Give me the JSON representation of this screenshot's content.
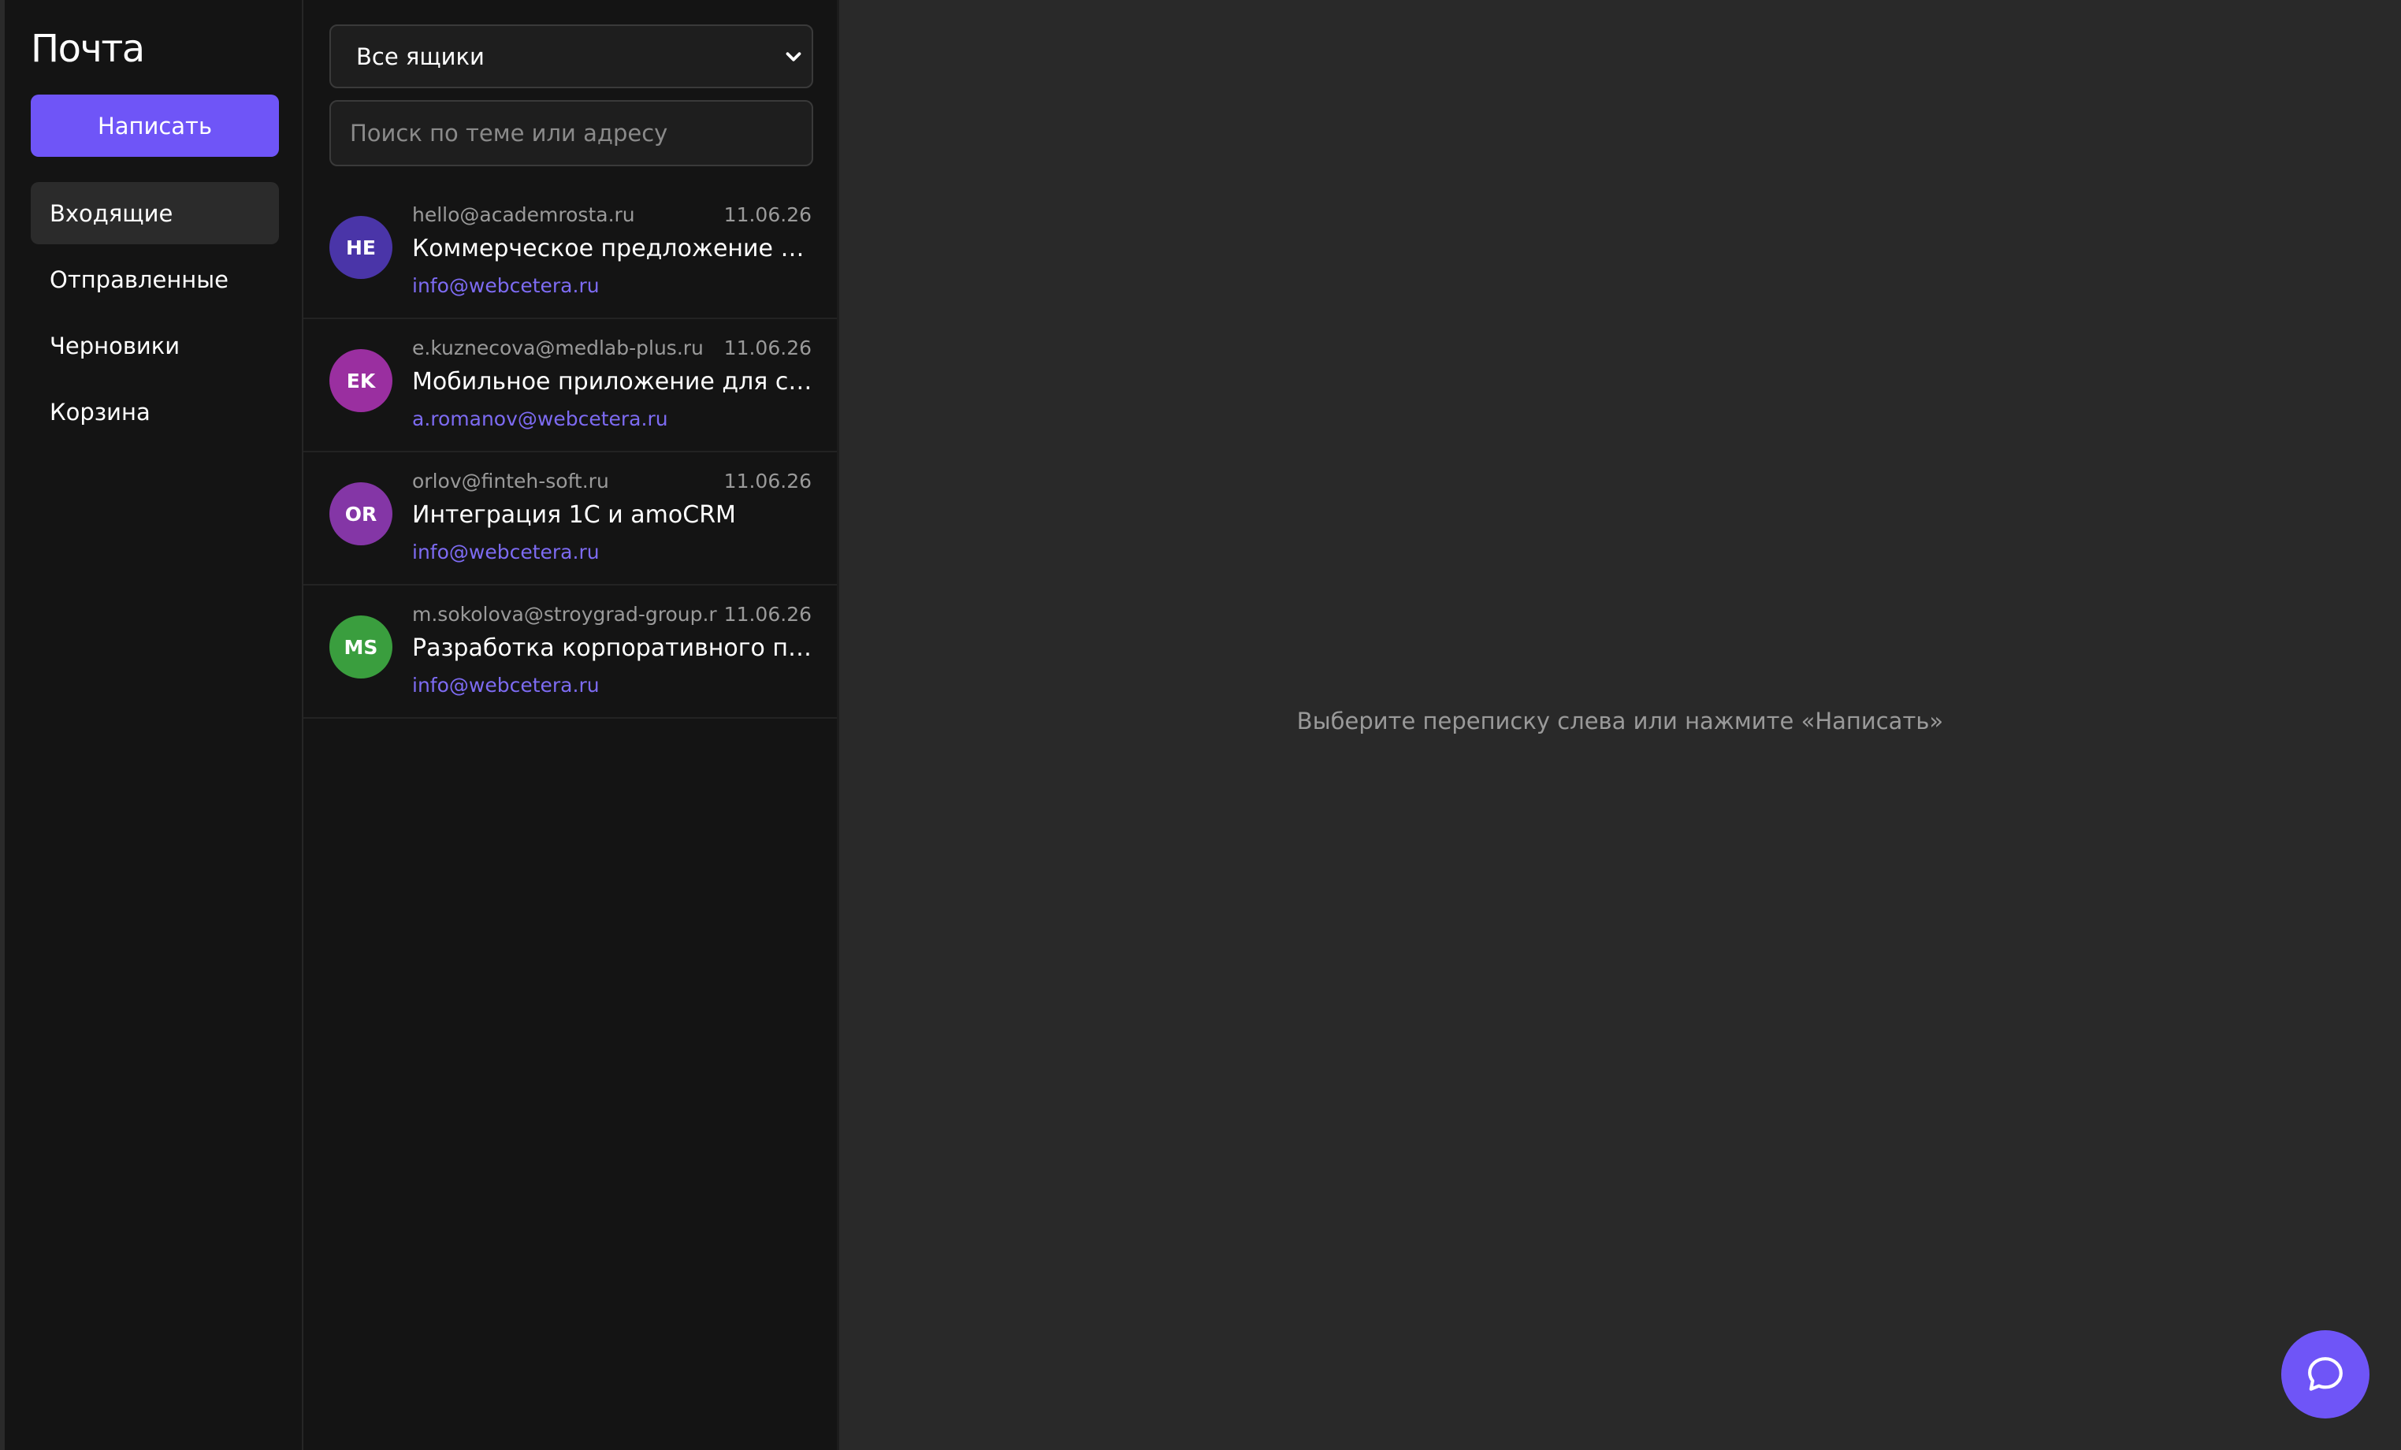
{
  "app": {
    "title": "Почта",
    "compose_label": "Написать"
  },
  "sidebar": {
    "items": [
      {
        "label": "Входящие",
        "active": true
      },
      {
        "label": "Отправленные",
        "active": false
      },
      {
        "label": "Черновики",
        "active": false
      },
      {
        "label": "Корзина",
        "active": false
      }
    ]
  },
  "list": {
    "mailbox_selected": "Все ящики",
    "search_placeholder": "Поиск по теме или адресу",
    "messages": [
      {
        "initials": "HE",
        "avatar_color": "#4a35a8",
        "from": "hello@academrosta.ru",
        "date": "11.06.26",
        "subject": "Коммерческое предложение по продвижению сайта",
        "to": "info@webcetera.ru"
      },
      {
        "initials": "EK",
        "avatar_color": "#9a2fa0",
        "from": "e.kuznecova@medlab-plus.ru",
        "date": "11.06.26",
        "subject": "Мобильное приложение для сети клиник",
        "to": "a.romanov@webcetera.ru"
      },
      {
        "initials": "OR",
        "avatar_color": "#8436a6",
        "from": "orlov@finteh-soft.ru",
        "date": "11.06.26",
        "subject": "Интеграция 1С и amoCRM",
        "to": "info@webcetera.ru"
      },
      {
        "initials": "MS",
        "avatar_color": "#3a9e3e",
        "from": "m.sokolova@stroygrad-group.ru",
        "date": "11.06.26",
        "subject": "Разработка корпоративного портала",
        "to": "info@webcetera.ru"
      }
    ]
  },
  "reading": {
    "empty_hint": "Выберите переписку слева или нажмите «Написать»"
  },
  "icons": {
    "chat_fab": "chat-bubble-icon",
    "select_chevron": "chevron-down-icon"
  },
  "colors": {
    "accent": "#6f55f7",
    "link": "#7d6bf2"
  }
}
